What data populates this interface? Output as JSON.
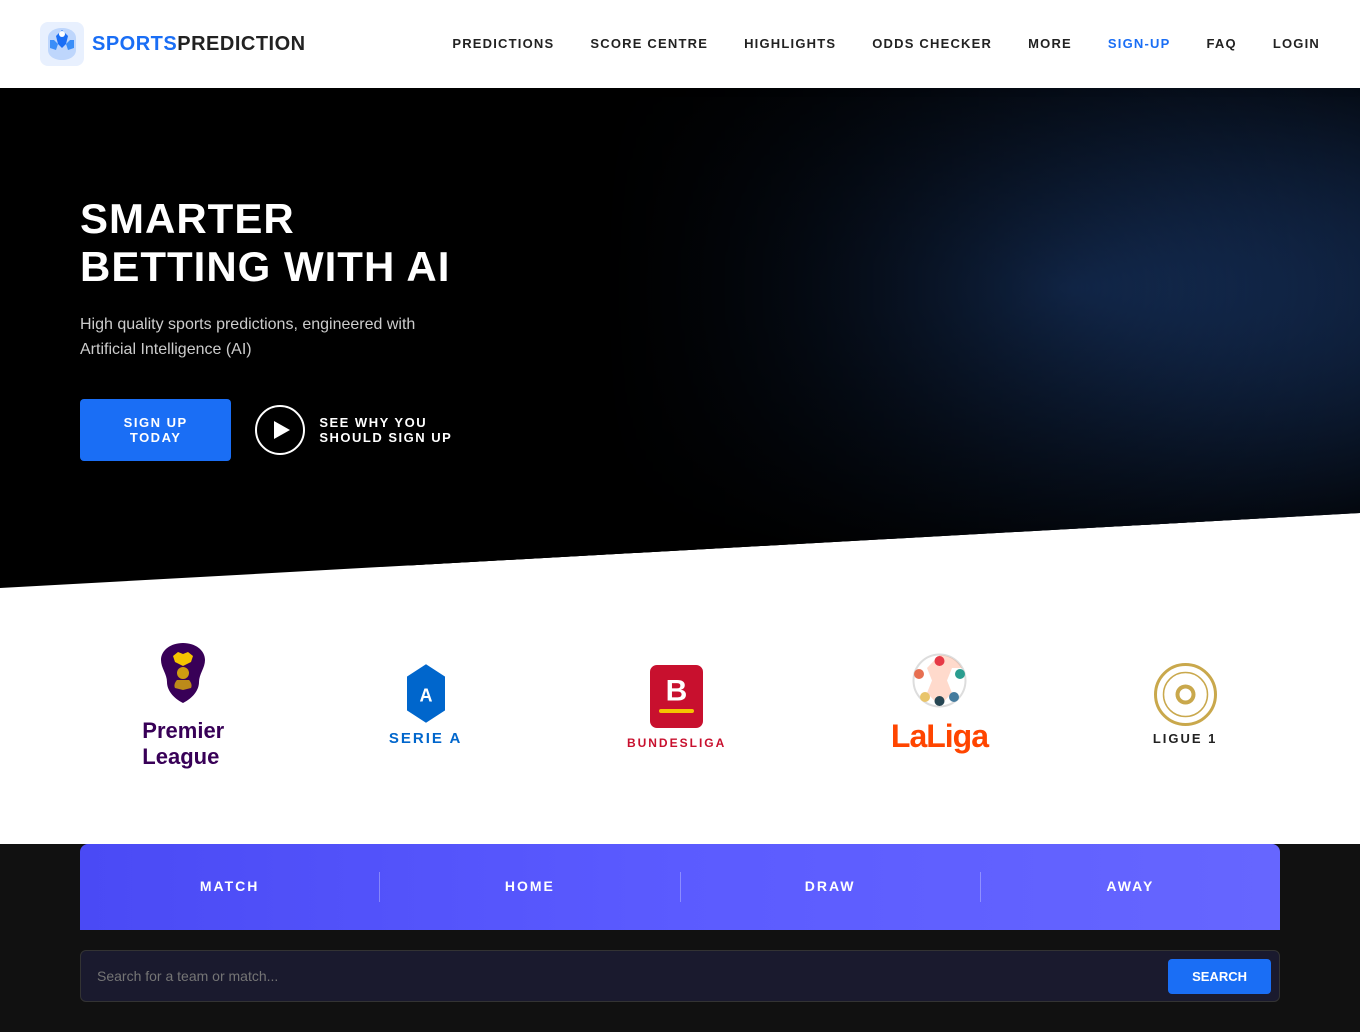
{
  "nav": {
    "logo": {
      "sports": "SPORTS",
      "prediction": "PREDICTION"
    },
    "links": [
      {
        "id": "predictions",
        "label": "PREDICTIONS"
      },
      {
        "id": "score-centre",
        "label": "SCORE CENTRE"
      },
      {
        "id": "highlights",
        "label": "HIGHLIGHTS"
      },
      {
        "id": "odds-checker",
        "label": "ODDS CHECKER"
      },
      {
        "id": "more",
        "label": "MORE"
      },
      {
        "id": "sign-up",
        "label": "SIGN-UP"
      },
      {
        "id": "faq",
        "label": "FAQ"
      },
      {
        "id": "login",
        "label": "LOGIN"
      }
    ]
  },
  "hero": {
    "title": "SMARTER BETTING WITH AI",
    "subtitle": "High quality sports predictions, engineered with Artificial Intelligence (AI)",
    "signup_btn": "SIGN UP TODAY",
    "play_text": "SEE WHY YOU SHOULD SIGN UP"
  },
  "leagues": [
    {
      "id": "premier-league",
      "name": "Premier League",
      "color": "#380057"
    },
    {
      "id": "serie-a",
      "name": "SERIE A",
      "color": "#0066cc"
    },
    {
      "id": "bundesliga",
      "name": "BUNDESLIGA",
      "color": "#c8102e"
    },
    {
      "id": "laliga",
      "name": "LaLiga",
      "color": "#ff4500"
    },
    {
      "id": "ligue-1",
      "name": "LIGUE 1",
      "color": "#c9a84c"
    }
  ],
  "predictions_bar": {
    "columns": [
      {
        "id": "match",
        "label": "MATCH"
      },
      {
        "id": "home",
        "label": "HOME"
      },
      {
        "id": "draw",
        "label": "DRAW"
      },
      {
        "id": "away",
        "label": "AWAY"
      }
    ]
  },
  "search": {
    "placeholder": "Search for a team or match...",
    "button_label": "SEARCH"
  },
  "colors": {
    "primary": "#1a6ef5",
    "dark": "#111111",
    "bar_gradient_start": "#4a4af5",
    "bar_gradient_end": "#6666ff"
  }
}
